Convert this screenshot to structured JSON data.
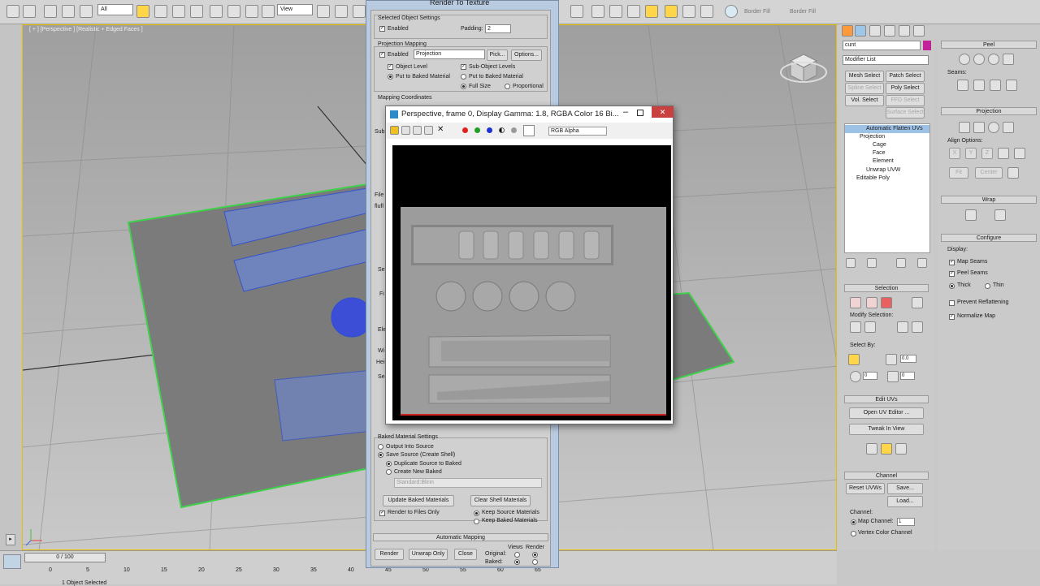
{
  "toolbar": {
    "selection_filter": "All",
    "ref_coord": "View",
    "border_fill_1": "Border Fill",
    "border_fill_2": "Border Fill"
  },
  "viewport": {
    "label": "[ + ] [Perspective ] [Realistic + Edged Faces ]"
  },
  "timeline": {
    "frame_counter": "0 / 100",
    "ticks": [
      "0",
      "5",
      "10",
      "15",
      "20",
      "25",
      "30",
      "35",
      "40",
      "45",
      "50",
      "55",
      "60",
      "65"
    ],
    "status": "1 Object Selected"
  },
  "modify_panel": {
    "object_name": "cunt",
    "modifier_list": "Modifier List",
    "buttons": [
      "Mesh Select",
      "Patch Select",
      "Spline Select",
      "Poly Select",
      "Vol. Select",
      "FFD Select",
      "Surface Select"
    ],
    "stack": [
      "Automatic Flatten UVs",
      "Projection",
      "Cage",
      "Face",
      "Element",
      "Unwrap UVW",
      "Editable Poly"
    ],
    "selection": {
      "title": "Selection",
      "modify_selection": "Modify Selection:",
      "select_by": "Select By:",
      "spinner_a": "0.0",
      "spinner_b": "0",
      "spinner_c": "0"
    },
    "edit_uvs": {
      "title": "Edit UVs",
      "open": "Open UV Editor ...",
      "tweak": "Tweak In View"
    },
    "channel": {
      "title": "Channel",
      "reset": "Reset UVWs",
      "save": "Save...",
      "load": "Load...",
      "map_channel_label": "Channel:",
      "map_channel": "Map Channel:",
      "map_channel_value": "1",
      "vertex_color": "Vertex Color Channel"
    }
  },
  "unwrap_panel": {
    "peel": "Peel",
    "seams": "Seams:",
    "projection": "Projection",
    "align_options": "Align Options:",
    "align_x": "X",
    "align_y": "Y",
    "align_z": "Z",
    "fit": "Fit",
    "center": "Center",
    "wrap": "Wrap",
    "configure": "Configure",
    "display": "Display:",
    "map_seams": "Map Seams",
    "peel_seams": "Peel Seams",
    "thick": "Thick",
    "thin": "Thin",
    "prevent_reflattening": "Prevent Reflattening",
    "normalize_map": "Normalize Map"
  },
  "rtt": {
    "title": "Render To Texture",
    "selected_settings": "Selected Object Settings",
    "enabled": "Enabled",
    "padding_label": "Padding:",
    "padding_value": "2",
    "projection_mapping": "Projection Mapping",
    "enabled2": "Enabled",
    "projection_select": "Projection",
    "pick": "Pick...",
    "options": "Options...",
    "object_level": "Object Level",
    "sub_object_levels": "Sub-Object Levels",
    "put_to_baked": "Put to Baked Material",
    "put_to_baked2": "Put to Baked Material",
    "full_size": "Full Size",
    "proportional": "Proportional",
    "mapping_coords": "Mapping Coordinates",
    "side_frag": [
      "Sub",
      "File",
      "flufl",
      "Se",
      "Fi",
      "Ele",
      "Wi",
      "Hei",
      "Se"
    ],
    "baked_title": "Baked Material Settings",
    "output_into_source": "Output Into Source",
    "save_source": "Save Source (Create Shell)",
    "duplicate_source": "Duplicate Source to Baked",
    "create_new_baked": "Create New Baked",
    "standard_blinn": "Standard:Blinn",
    "update_baked": "Update Baked Materials",
    "clear_shell": "Clear Shell Materials",
    "render_to_files": "Render to Files Only",
    "keep_source": "Keep Source Materials",
    "keep_baked": "Keep Baked Materials",
    "automatic_mapping": "Automatic Mapping",
    "render": "Render",
    "unwrap_only": "Unwrap Only",
    "close": "Close",
    "views": "Views",
    "render_col": "Render",
    "original": "Original:",
    "baked": "Baked:"
  },
  "vfb": {
    "title": "Perspective, frame 0, Display Gamma: 1.8, RGBA Color 16 Bi...",
    "channel": "RGB Alpha"
  }
}
